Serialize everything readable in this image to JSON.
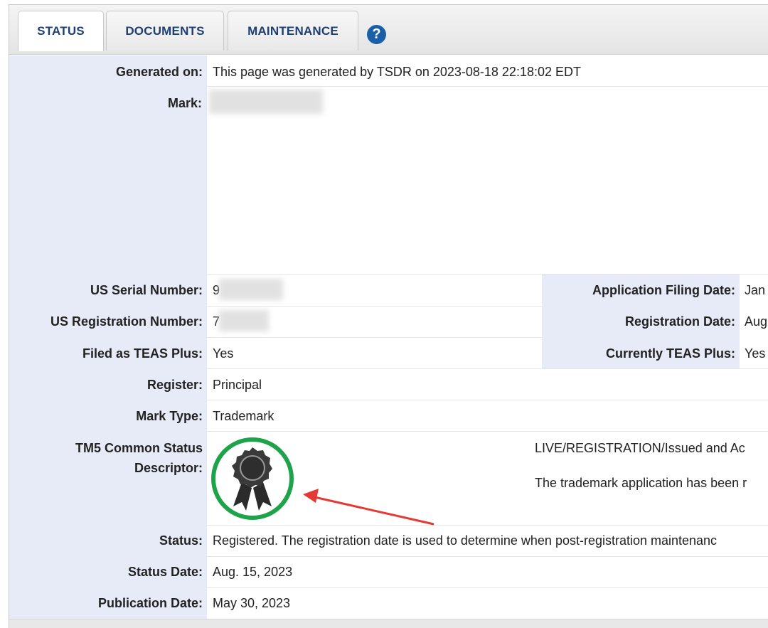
{
  "tabs": [
    {
      "label": "STATUS",
      "active": true
    },
    {
      "label": "DOCUMENTS",
      "active": false
    },
    {
      "label": "MAINTENANCE",
      "active": false
    }
  ],
  "help_icon": "question-mark-icon",
  "colors": {
    "label_bg": "#e7ebf7",
    "tab_text": "#1f3f73",
    "help_blue": "#1b5fa8",
    "badge_ring": "#1ea34a",
    "arrow": "#e53935"
  },
  "fields": {
    "generated_on": {
      "label": "Generated on:",
      "value": "This page was generated by TSDR on 2023-08-18 22:18:02 EDT"
    },
    "mark": {
      "label": "Mark:"
    },
    "serial": {
      "label": "US Serial Number:",
      "value": "9"
    },
    "filing_date": {
      "label": "Application Filing Date:",
      "value": "Jan"
    },
    "reg_number": {
      "label": "US Registration Number:",
      "value": "7"
    },
    "reg_date": {
      "label": "Registration Date:",
      "value": "Aug"
    },
    "teas_plus": {
      "label": "Filed as TEAS Plus:",
      "value": "Yes"
    },
    "currently_teas": {
      "label": "Currently TEAS Plus:",
      "value": "Yes"
    },
    "register": {
      "label": "Register:",
      "value": "Principal"
    },
    "mark_type": {
      "label": "Mark Type:",
      "value": "Trademark"
    },
    "tm5": {
      "label_line1": "TM5 Common Status",
      "label_line2": "Descriptor:",
      "badge_icon": "award-ribbon-icon",
      "status_line": "LIVE/REGISTRATION/Issued and Ac",
      "desc_line": "The trademark application has been r"
    },
    "status": {
      "label": "Status:",
      "value": "Registered. The registration date is used to determine when post-registration maintenanc"
    },
    "status_date": {
      "label": "Status Date:",
      "value": "Aug. 15, 2023"
    },
    "publication_date": {
      "label": "Publication Date:",
      "value": "May 30, 2023"
    }
  }
}
